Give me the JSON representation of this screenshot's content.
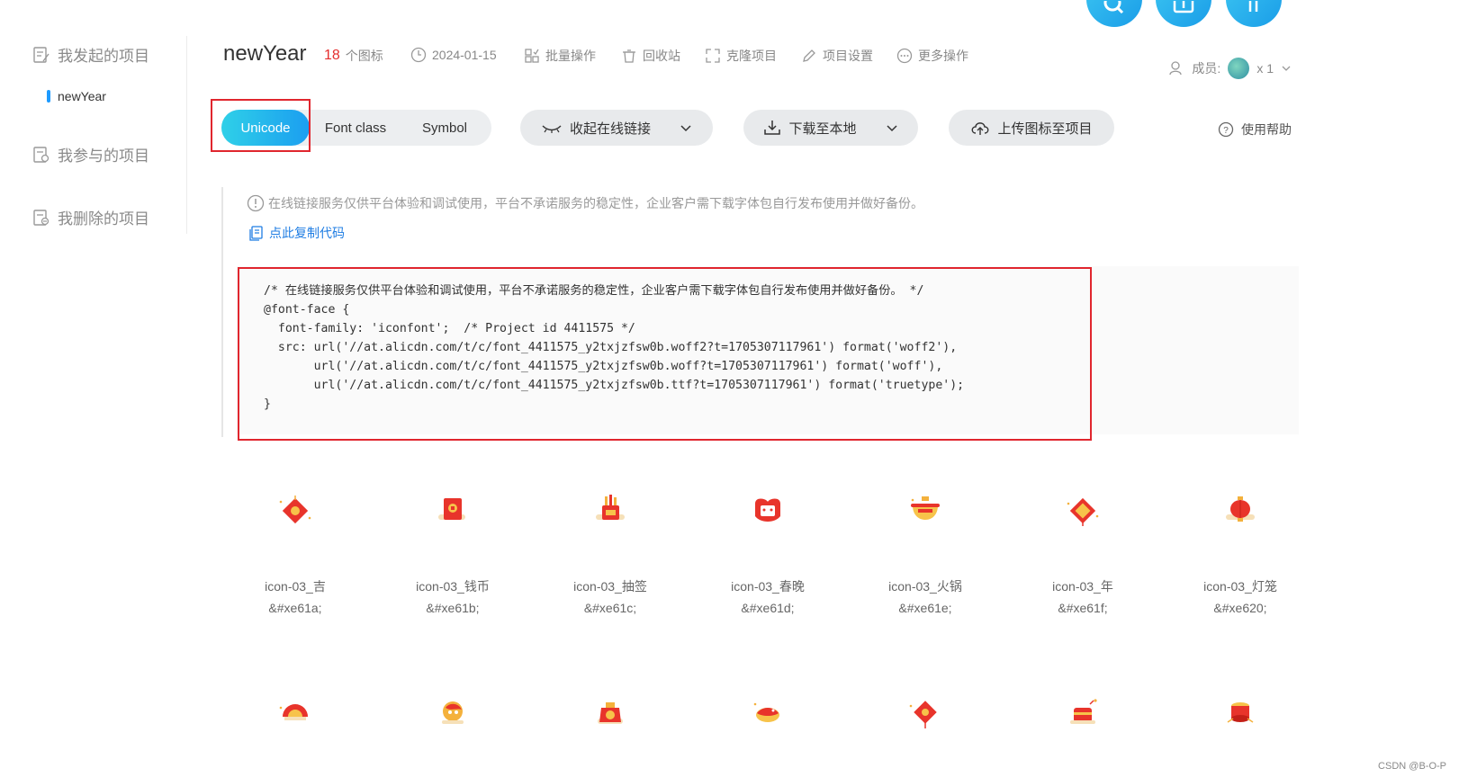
{
  "sidebar": {
    "items": [
      {
        "label": "我发起的项目"
      },
      {
        "label": "我参与的项目"
      },
      {
        "label": "我删除的项目"
      }
    ],
    "sub_item": "newYear"
  },
  "header": {
    "title": "newYear",
    "icon_count": "18",
    "icon_count_unit": "个图标",
    "date": "2024-01-15",
    "actions": [
      "批量操作",
      "回收站",
      "克隆项目",
      "项目设置",
      "更多操作"
    ],
    "member_label": "成员:",
    "member_count": "x 1"
  },
  "tabs": {
    "items": [
      "Unicode",
      "Font class",
      "Symbol"
    ],
    "active": "Unicode"
  },
  "toolbar": {
    "collapse_label": "收起在线链接",
    "download_label": "下载至本地",
    "upload_label": "上传图标至项目",
    "help_label": "使用帮助"
  },
  "notice": {
    "text": "在线链接服务仅供平台体验和调试使用，平台不承诺服务的稳定性，企业客户需下载字体包自行发布使用并做好备份。",
    "copy_label": "点此复制代码"
  },
  "code": {
    "lines": [
      "/* 在线链接服务仅供平台体验和调试使用，平台不承诺服务的稳定性，企业客户需下载字体包自行发布使用并做好备份。 */",
      "@font-face {",
      "  font-family: 'iconfont';  /* Project id 4411575 */",
      "  src: url('//at.alicdn.com/t/c/font_4411575_y2txjzfsw0b.woff2?t=1705307117961') format('woff2'),",
      "       url('//at.alicdn.com/t/c/font_4411575_y2txjzfsw0b.woff?t=1705307117961') format('woff'),",
      "       url('//at.alicdn.com/t/c/font_4411575_y2txjzfsw0b.ttf?t=1705307117961') format('truetype');",
      "}"
    ]
  },
  "icons": [
    {
      "name": "icon-03_吉",
      "code": "&#xe61a;",
      "icon": "diamond-lantern-icon",
      "color": "#e8342b"
    },
    {
      "name": "icon-03_钱币",
      "code": "&#xe61b;",
      "icon": "coin-envelope-icon",
      "color": "#e8342b"
    },
    {
      "name": "icon-03_抽签",
      "code": "&#xe61c;",
      "icon": "fortune-sticks-icon",
      "color": "#e8342b"
    },
    {
      "name": "icon-03_春晚",
      "code": "&#xe61d;",
      "icon": "tv-gala-icon",
      "color": "#e8342b"
    },
    {
      "name": "icon-03_火锅",
      "code": "&#xe61e;",
      "icon": "hotpot-icon",
      "color": "#e8342b"
    },
    {
      "name": "icon-03_年",
      "code": "&#xe61f;",
      "icon": "nian-diamond-icon",
      "color": "#e8342b"
    },
    {
      "name": "icon-03_灯笼",
      "code": "&#xe620;",
      "icon": "lantern-icon",
      "color": "#e8342b"
    }
  ],
  "icons_row2": [
    {
      "icon": "fan-icon"
    },
    {
      "icon": "lion-dance-icon"
    },
    {
      "icon": "bag-icon"
    },
    {
      "icon": "dragon-boat-icon"
    },
    {
      "icon": "diamond-charm-icon"
    },
    {
      "icon": "firecracker-icon"
    },
    {
      "icon": "drum-icon"
    }
  ],
  "watermark": "CSDN @B-O-P"
}
